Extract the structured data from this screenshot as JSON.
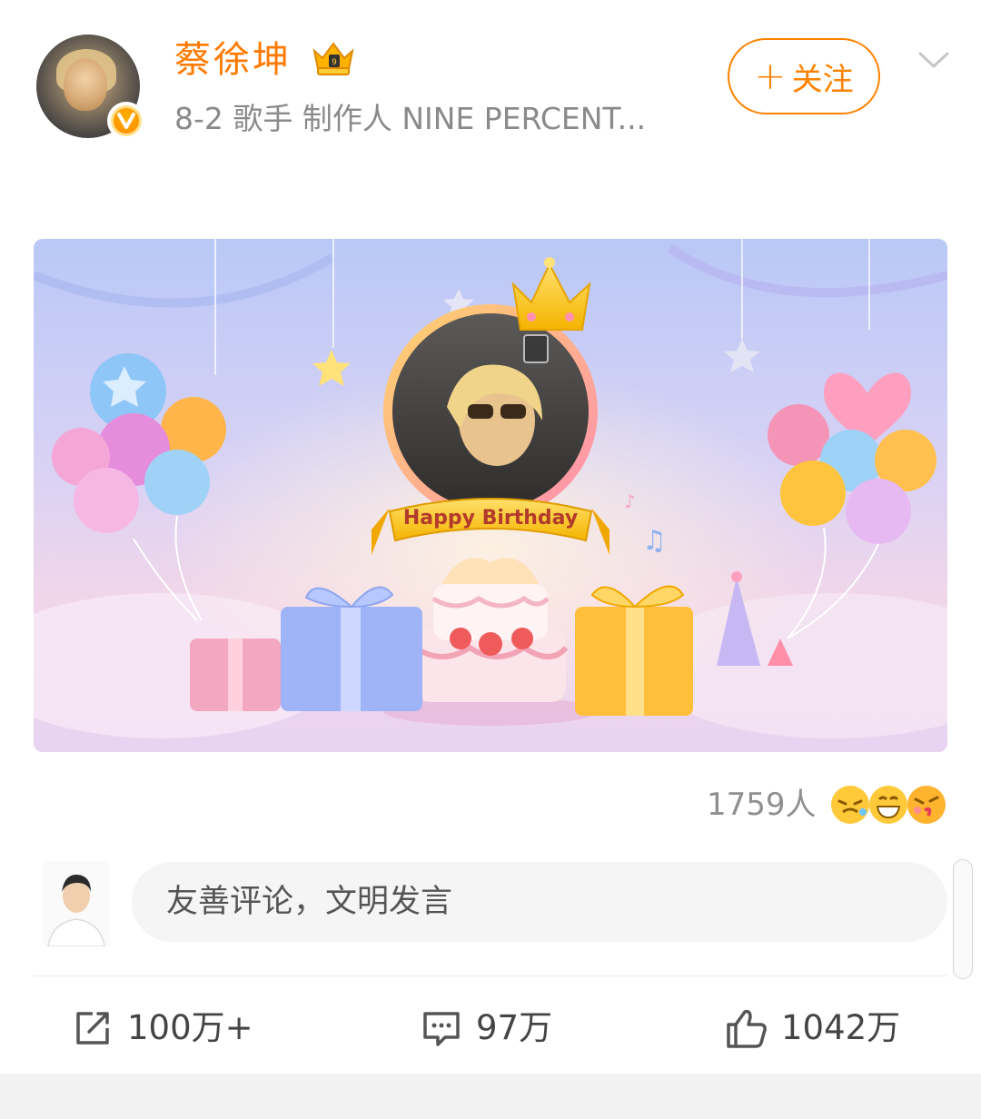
{
  "post_header": {
    "user_name": "蔡徐坤",
    "meta": "8-2   歌手 制作人 NINE PERCENT...",
    "follow_label": "关注",
    "accent_color": "#ff8200"
  },
  "banner": {
    "text": "Happy Birthday"
  },
  "reactions": {
    "count_label": "1759人",
    "emojis": [
      "tears-of-joy-emoji",
      "grin-emoji",
      "kiss-emoji"
    ]
  },
  "comment": {
    "placeholder": "友善评论，文明发言"
  },
  "actions": {
    "repost_count": "100万+",
    "comment_count": "97万",
    "like_count": "1042万"
  }
}
